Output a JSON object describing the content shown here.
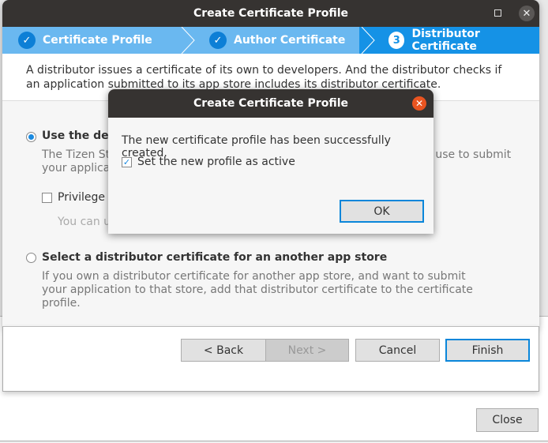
{
  "background_window": {
    "close_label": "Close"
  },
  "wizard": {
    "title": "Create Certificate Profile",
    "steps": [
      {
        "label": "Certificate Profile",
        "state": "done"
      },
      {
        "label": "Author Certificate",
        "state": "done"
      },
      {
        "label": "Distributor Certificate",
        "number": "3",
        "state": "active"
      }
    ],
    "description": "A distributor issues a certificate of its own to developers. And the distributor checks if an application submitted to its app store includes its distributor certificate.",
    "option_default": {
      "label": "Use the def",
      "desc_line1_left": "The Tizen Stu",
      "desc_line1_right": "n use to submit",
      "desc_line2": "your applica",
      "privilege_label": "Privilege l",
      "privilege_hint": "You can u"
    },
    "option_other": {
      "label": "Select a distributor certificate for an another app store",
      "desc": "If you own a distributor certificate for another app store, and want to submit your application to that store, add that distributor certificate to the certificate profile."
    },
    "buttons": {
      "back": "< Back",
      "next": "Next >",
      "cancel": "Cancel",
      "finish": "Finish"
    }
  },
  "dialog": {
    "title": "Create Certificate Profile",
    "message": "The new certificate profile has been successfully created.",
    "checkbox_label": "Set the new profile as active",
    "checkbox_checked": true,
    "ok_label": "OK"
  },
  "colors": {
    "accent": "#1592e6",
    "step_done": "#6ab8f0",
    "title_bar": "#363331",
    "dialog_close": "#e95420"
  }
}
